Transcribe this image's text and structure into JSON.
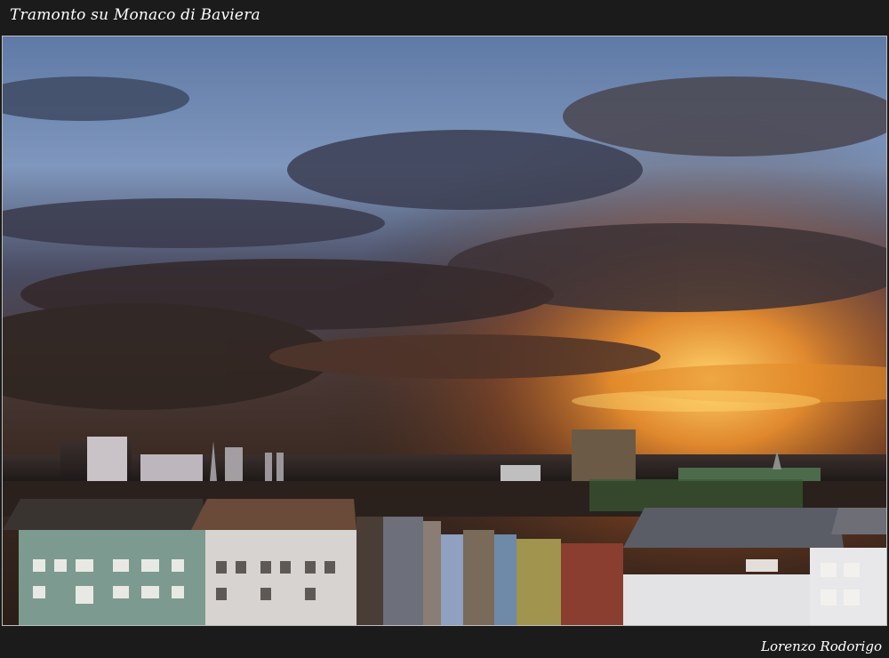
{
  "header": {
    "title": "Tramonto su Monaco di Baviera"
  },
  "footer": {
    "author": "Lorenzo Rodorigo"
  },
  "photo": {
    "description_icon": "sunset-city-photo"
  }
}
